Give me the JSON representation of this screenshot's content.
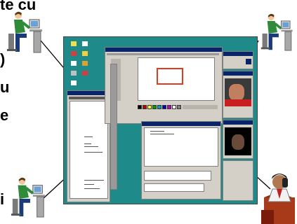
{
  "side_text": [
    "te cu",
    ")",
    "u",
    "e",
    "i"
  ],
  "colors": {
    "desktop": "#1f8a8a",
    "window_face": "#d4d0c8",
    "title_bar": "#0a246a",
    "selection_rect": "#e03a1e",
    "figure_shirt": "#2f8a3a",
    "figure_pants": "#1a3a7a",
    "figure_hair": "#5a3a1a",
    "figure_skin": "#f2c89a"
  },
  "figures": [
    {
      "name": "top-left-user",
      "icon": "person-at-computer-icon"
    },
    {
      "name": "top-right-user",
      "icon": "person-at-computer-icon"
    },
    {
      "name": "bottom-left-user",
      "icon": "person-at-computer-icon"
    },
    {
      "name": "bottom-right-user",
      "icon": "person-on-phone-icon"
    }
  ]
}
